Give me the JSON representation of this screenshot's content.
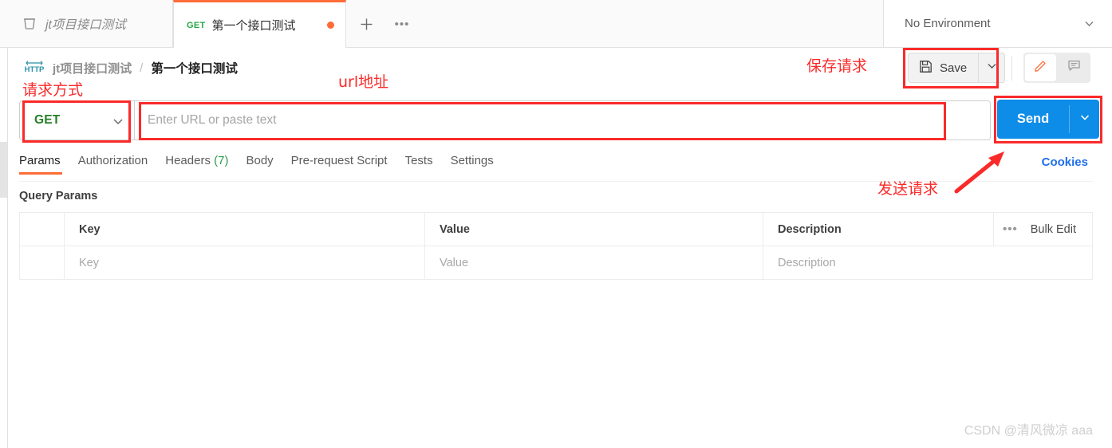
{
  "tabbar": {
    "collection_tab": {
      "name": "jt项目接口测试",
      "icon": "collection-icon"
    },
    "request_tab": {
      "method": "GET",
      "title": "第一个接口测试",
      "unsaved": true
    },
    "new_tab_label": "+",
    "more_label": "•••",
    "environment": {
      "label": "No Environment"
    }
  },
  "breadcrumb": {
    "protocol_badge": "HTTP",
    "parent": "jt项目接口测试",
    "separator": "/",
    "current": "第一个接口测试"
  },
  "toolbar": {
    "save_label": "Save",
    "save_icon": "floppy-disk-icon",
    "save_caret_icon": "chevron-down-icon",
    "edit_icon": "pencil-icon",
    "comment_icon": "comment-icon"
  },
  "urlbar": {
    "method": "GET",
    "method_caret_icon": "chevron-down-icon",
    "url_value": "",
    "url_placeholder": "Enter URL or paste text",
    "send_label": "Send",
    "send_caret_icon": "chevron-down-icon"
  },
  "request_tabs": {
    "items": [
      {
        "label": "Params",
        "active": true
      },
      {
        "label": "Authorization",
        "active": false
      },
      {
        "label": "Headers",
        "count": "(7)",
        "active": false
      },
      {
        "label": "Body",
        "active": false
      },
      {
        "label": "Pre-request Script",
        "active": false
      },
      {
        "label": "Tests",
        "active": false
      },
      {
        "label": "Settings",
        "active": false
      }
    ],
    "cookies_link": "Cookies"
  },
  "query_params": {
    "section_title": "Query Params",
    "headers": [
      "",
      "Key",
      "Value",
      "Description"
    ],
    "bulk_dots": "•••",
    "bulk_edit_label": "Bulk Edit",
    "rows": [
      {
        "key_placeholder": "Key",
        "value_placeholder": "Value",
        "description_placeholder": "Description"
      }
    ]
  },
  "annotations": [
    {
      "name": "request-method",
      "text": "请求方式"
    },
    {
      "name": "url-address",
      "text": "url地址"
    },
    {
      "name": "save-request",
      "text": "保存请求"
    },
    {
      "name": "send-request",
      "text": "发送请求"
    }
  ],
  "watermark": {
    "text": "CSDN @清风微凉 aaa"
  },
  "colors": {
    "accent_orange": "#ff6c37",
    "send_blue": "#0d8ce8",
    "method_green": "#268026",
    "annotation_red": "#fa2a2a",
    "link_blue": "#1f6fea"
  }
}
